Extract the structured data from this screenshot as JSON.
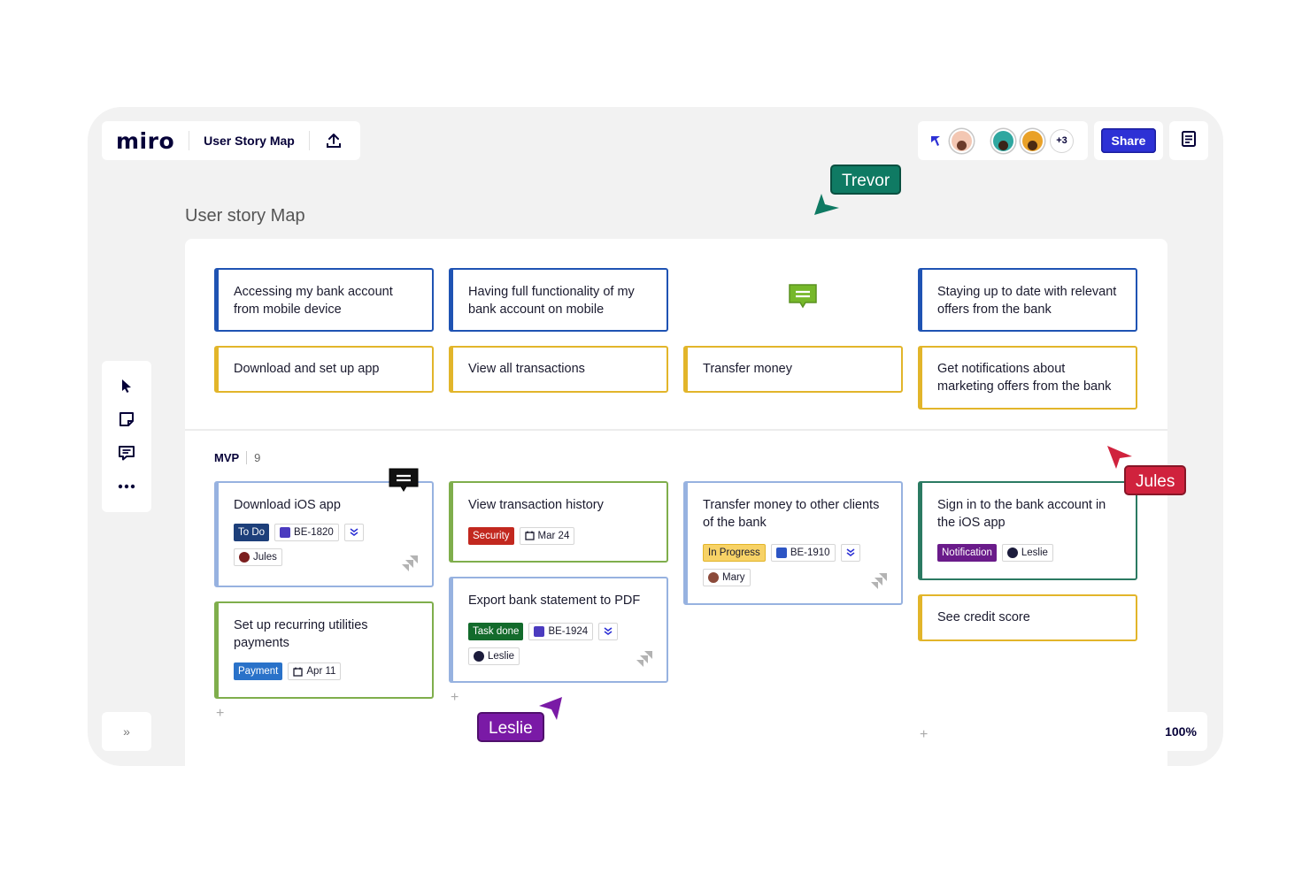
{
  "app": {
    "logo": "miro",
    "board_title": "User Story Map",
    "share_label": "Share",
    "more_users": "+3",
    "zoom_level": "100%",
    "expand_glyph": "»"
  },
  "board": {
    "title": "User story Map",
    "epics": [
      {
        "text": "Accessing my bank account from mobile device"
      },
      {
        "text": "Having full functionality of my bank account on mobile"
      },
      {
        "text": "Staying up to date with relevant offers from the bank"
      }
    ],
    "activities": [
      {
        "text": "Download and set up app"
      },
      {
        "text": "View all transactions"
      },
      {
        "text": "Transfer money"
      },
      {
        "text": "Get notifications about marketing offers from the bank"
      }
    ],
    "release": {
      "name": "MVP",
      "count": "9"
    },
    "stories": {
      "download_ios": {
        "text": "Download iOS app",
        "status": "To Do",
        "ticket": "BE-1820",
        "assignee": "Jules"
      },
      "recurring": {
        "text": "Set up recurring utilities payments",
        "tag": "Payment",
        "date": "Apr 11"
      },
      "view_history": {
        "text": "View transaction history",
        "tag": "Security",
        "date": "Mar 24"
      },
      "export_pdf": {
        "text": "Export bank statement to PDF",
        "status": "Task done",
        "ticket": "BE-1924",
        "assignee": "Leslie"
      },
      "transfer_clients": {
        "text": "Transfer money to other clients of the bank",
        "status": "In Progress",
        "ticket": "BE-1910",
        "assignee": "Mary"
      },
      "sign_in": {
        "text": "Sign in to the bank account in the iOS app",
        "tag": "Notification",
        "assignee": "Leslie"
      },
      "credit_score": {
        "text": "See credit score"
      }
    }
  },
  "cursors": [
    {
      "name": "Trevor",
      "color": "#0f7a63"
    },
    {
      "name": "Jules",
      "color": "#d0223d"
    },
    {
      "name": "Leslie",
      "color": "#7a1aa6"
    }
  ],
  "colors": {
    "accent": "#2d31d5",
    "todo": "#1d3f7a",
    "security": "#c2281f",
    "task_done": "#136b2c",
    "payment": "#2a72c9",
    "notification": "#6a1b8a",
    "comment_green": "#76b82a"
  },
  "icons": [
    "cursor-mode-icon",
    "upload-icon",
    "notes-icon",
    "select-icon",
    "sticky-note-icon",
    "comment-icon",
    "more-icon",
    "jira-icon",
    "calendar-icon",
    "priority-icon"
  ]
}
